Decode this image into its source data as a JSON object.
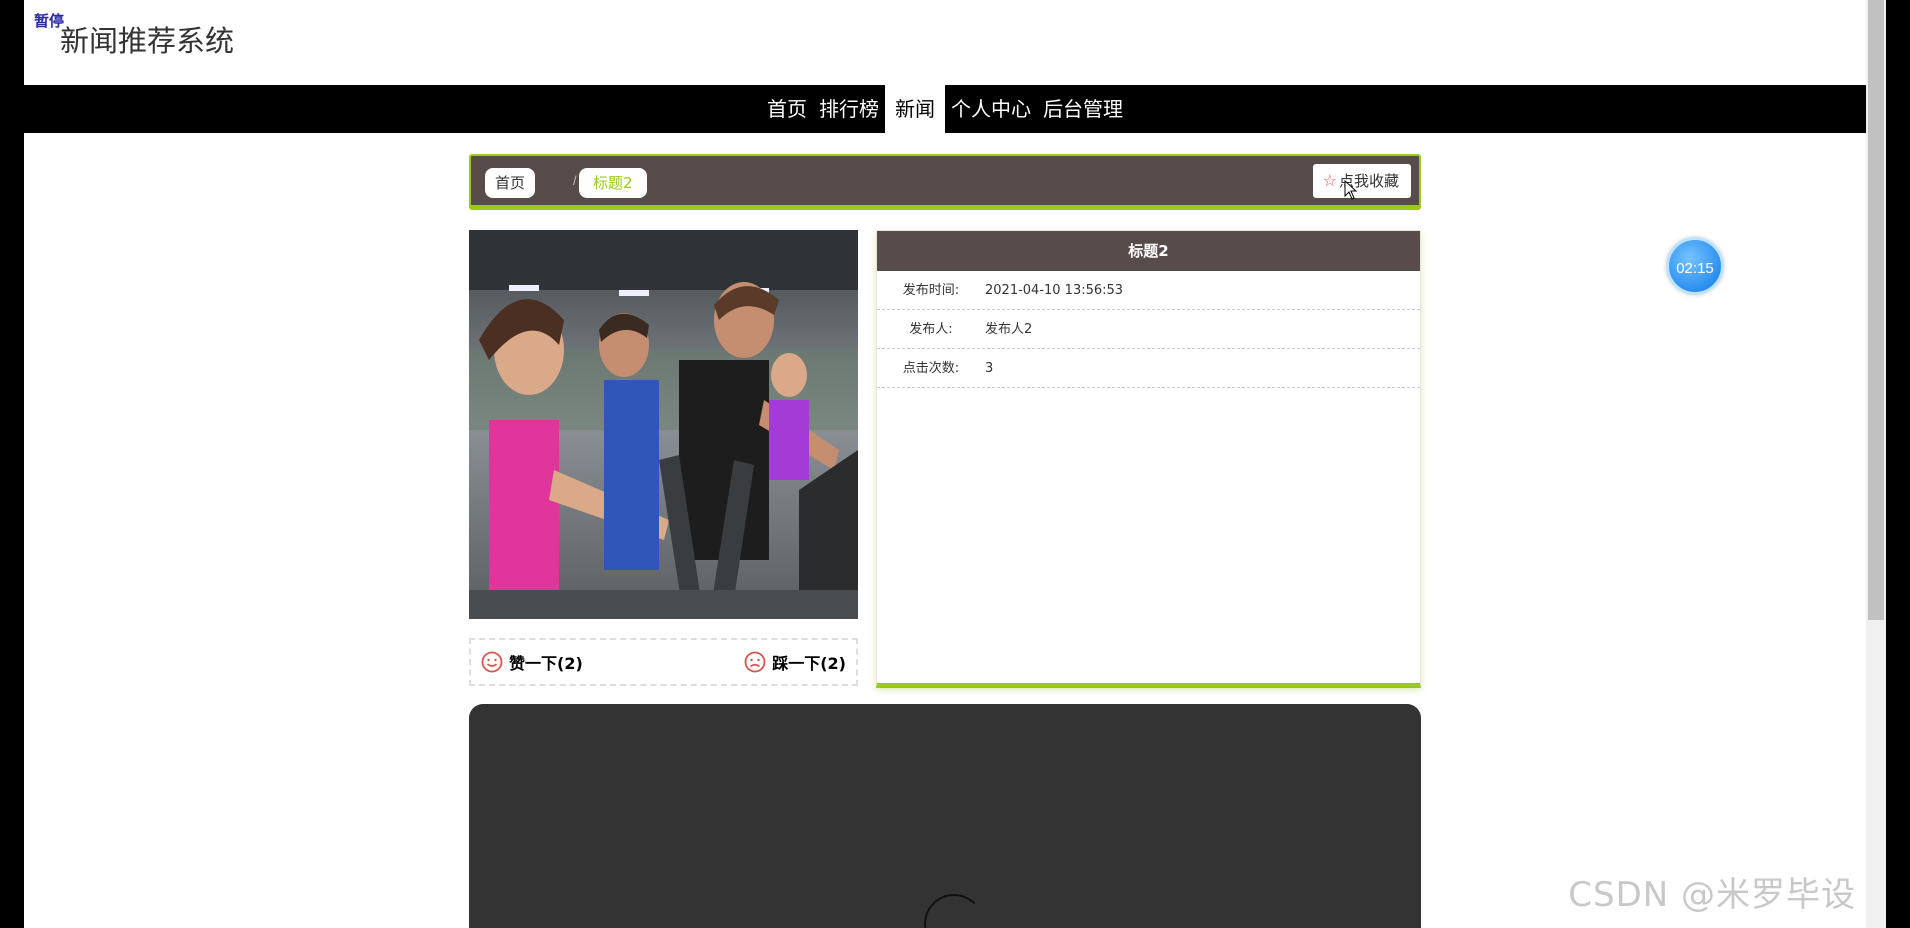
{
  "pause_label": "暂停",
  "site": {
    "title": "新闻推荐系统"
  },
  "nav": {
    "items": [
      {
        "label": "首页"
      },
      {
        "label": "排行榜"
      },
      {
        "label": "新闻",
        "active": true
      },
      {
        "label": "个人中心"
      },
      {
        "label": "后台管理"
      }
    ]
  },
  "breadcrumb": {
    "home": "首页",
    "separator": "/",
    "current": "标题2",
    "favorite_label": "点我收藏"
  },
  "detail": {
    "title": "标题2",
    "rows": [
      {
        "label": "发布时间:",
        "value": "2021-04-10 13:56:53"
      },
      {
        "label": "发布人:",
        "value": "发布人2"
      },
      {
        "label": "点击次数:",
        "value": "3"
      }
    ]
  },
  "votes": {
    "like_label": "赞一下(2)",
    "dislike_label": "踩一下(2)"
  },
  "timer": {
    "text": "02:15"
  },
  "watermark": "CSDN @米罗毕设",
  "colors": {
    "accent": "#9ac81f",
    "panel_header": "#574c49",
    "nav_bg": "#000000",
    "video_bg": "#333333"
  }
}
